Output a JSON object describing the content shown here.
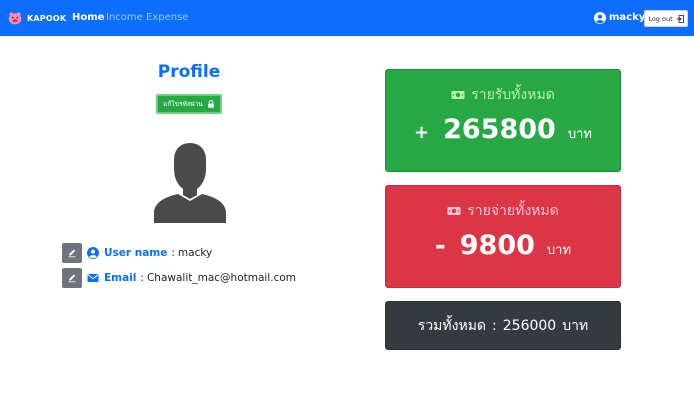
{
  "navbar": {
    "brand_name": "KAPOOK",
    "links": {
      "home": "Home",
      "income": "Income",
      "expense": "Expense"
    },
    "user_name": "macky",
    "logout_label": "Log out"
  },
  "profile": {
    "title": "Profile",
    "change_password_label": "แก้ไขรหัสผ่าน",
    "username": {
      "label": "User name",
      "separator": ":",
      "value": "macky"
    },
    "email": {
      "label": "Email",
      "separator": ":",
      "value": "Chawalit_mac@hotmail.com"
    }
  },
  "summary": {
    "income": {
      "title": "รายรับทั้งหมด",
      "sign": "+",
      "amount": "265800",
      "unit": "บาท"
    },
    "expense": {
      "title": "รายจ่ายทั้งหมด",
      "sign": "-",
      "amount": "9800",
      "unit": "บาท"
    },
    "total": {
      "label": "รวมทั้งหมด",
      "separator": ":",
      "amount": "256000",
      "unit": "บาท"
    }
  },
  "colors": {
    "primary": "#0d6efd",
    "success": "#28a745",
    "danger": "#dc3545",
    "dark": "#343a40",
    "secondary": "#6c757d"
  },
  "icons": {
    "brand": "piggy-bank-icon",
    "user": "user-circle-icon",
    "logout": "logout-icon",
    "lock": "lock-icon",
    "edit": "pencil-icon",
    "email": "envelope-icon",
    "money": "money-icon"
  }
}
